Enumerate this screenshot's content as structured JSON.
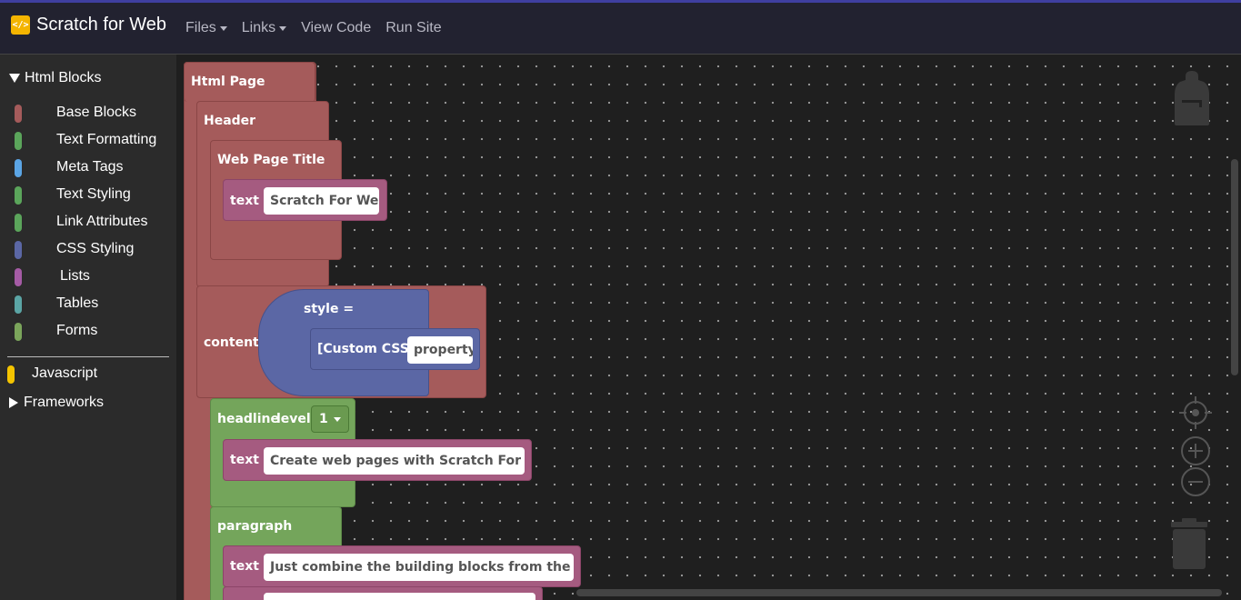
{
  "navbar": {
    "brand_logo": "</>",
    "brand_name": "Scratch for Web",
    "items": [
      {
        "label": "Files",
        "dropdown": true
      },
      {
        "label": "Links",
        "dropdown": true
      },
      {
        "label": "View Code",
        "dropdown": false
      },
      {
        "label": "Run Site",
        "dropdown": false
      }
    ]
  },
  "sidebar": {
    "html_blocks_label": "Html Blocks",
    "categories": [
      {
        "label": "Base Blocks",
        "color": "#a55b5b"
      },
      {
        "label": "Text Formatting",
        "color": "#5ba55b"
      },
      {
        "label": "Meta Tags",
        "color": "#5ba5e5"
      },
      {
        "label": "Text Styling",
        "color": "#5ba55b"
      },
      {
        "label": "Link Attributes",
        "color": "#5ba55b"
      },
      {
        "label": "CSS Styling",
        "color": "#5b67a5"
      },
      {
        "label": "Lists",
        "color": "#a55ba5"
      },
      {
        "label": "Tables",
        "color": "#5ba5a5"
      },
      {
        "label": "Forms",
        "color": "#7ba55b"
      }
    ],
    "javascript_label": "Javascript",
    "javascript_color": "#f4c400",
    "frameworks_label": "Frameworks"
  },
  "workspace": {
    "html_page": "Html Page",
    "header": "Header",
    "web_page_title": "Web Page Title",
    "text_label": "text",
    "title_text": "Scratch For Web",
    "content": "content",
    "style_eq": "style =",
    "custom_css": "[Custom CSS]",
    "property": "property",
    "headline": "headline",
    "level": "level",
    "level_value": "1",
    "headline_text": "Create web pages with Scratch For Web",
    "paragraph": "paragraph",
    "paragraph_text": "Just combine the building blocks from the left..."
  }
}
